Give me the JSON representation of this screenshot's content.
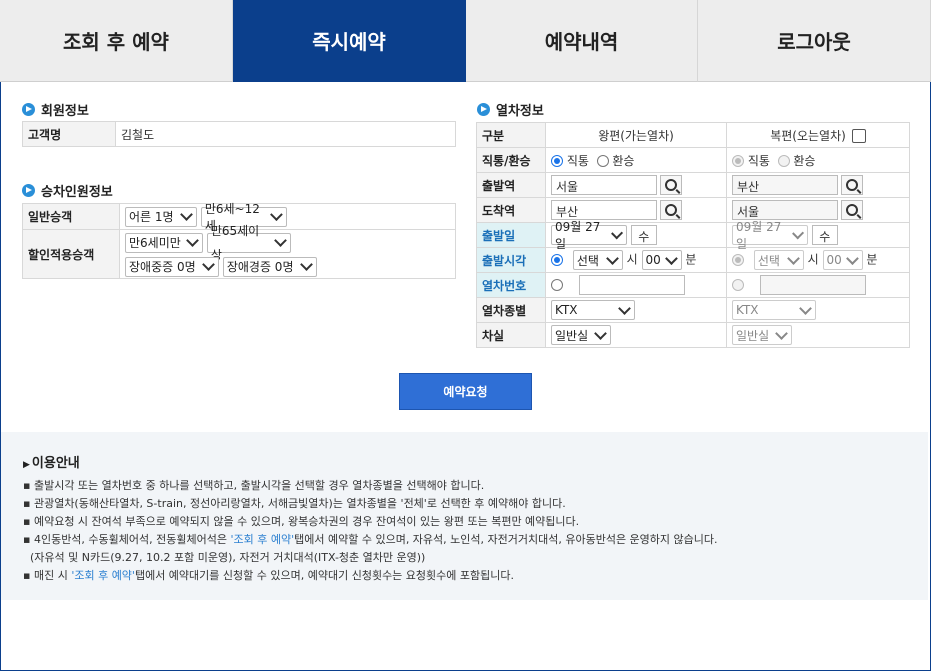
{
  "tabs": [
    {
      "label": "조회 후 예약",
      "active": false
    },
    {
      "label": "즉시예약",
      "active": true
    },
    {
      "label": "예약내역",
      "active": false
    },
    {
      "label": "로그아웃",
      "active": false
    }
  ],
  "member": {
    "title": "회원정보",
    "name_label": "고객명",
    "name_value": "김철도"
  },
  "passenger": {
    "title": "승차인원정보",
    "general_label": "일반승객",
    "adult": "어른 1명",
    "child": "만6세~12세",
    "discount_label": "할인적용승객",
    "under6": "만6세미만",
    "senior": "만65세이상",
    "disabled_severe": "장애중증 0명",
    "disabled_mild": "장애경증 0명"
  },
  "train": {
    "title": "열차정보",
    "col_label": "구분",
    "col_outbound": "왕편(가는열차)",
    "col_return": "복편(오는열차)",
    "row_direct": "직통/환승",
    "direct": "직통",
    "transfer": "환승",
    "row_dep": "출발역",
    "row_arr": "도착역",
    "row_date": "출발일",
    "row_time": "출발시각",
    "row_trainno": "열차번호",
    "row_type": "열차종별",
    "row_seat": "차실",
    "out": {
      "dep": "서울",
      "arr": "부산",
      "date": "09월 27일",
      "day": "수",
      "hour_sel": "선택",
      "hour_unit": "시",
      "min": "00",
      "min_unit": "분",
      "type": "KTX",
      "seat": "일반실"
    },
    "ret": {
      "dep": "부산",
      "arr": "서울",
      "date": "09월 27일",
      "day": "수",
      "hour_sel": "선택",
      "hour_unit": "시",
      "min": "00",
      "min_unit": "분",
      "type": "KTX",
      "seat": "일반실"
    }
  },
  "request_button": "예약요청",
  "info": {
    "title": "이용안내",
    "items": [
      "출발시각 또는 열차번호 중 하나를 선택하고, 출발시각을 선택할 경우 열차종별을 선택해야 합니다.",
      "관광열차(동해산타열차, S-train, 정선아리랑열차, 서해금빛열차)는 열차종별을 '전체'로 선택한 후 예약해야 합니다.",
      "예약요청 시 잔여석 부족으로 예약되지 않을 수 있으며, 왕복승차권의 경우 잔여석이 있는 왕편 또는 복편만 예약됩니다."
    ],
    "item4_a": "4인동반석, 수동휠체어석, 전동휠체어석은 ",
    "item4_link": "'조회 후 예약'",
    "item4_b": "탭에서 예약할 수 있으며, 자유석, 노인석, 자전거거치대석, 유아동반석은 운영하지 않습니다.",
    "item4_c": "(자유석 및 N카드(9.27, 10.2 포함 미운영), 자전거 거치대석(ITX-청춘 열차만 운영))",
    "item5_a": "매진 시 ",
    "item5_link": "'조회 후 예약'",
    "item5_b": "탭에서 예약대기를 신청할 수 있으며, 예약대기 신청횟수는 요청횟수에 포함됩니다."
  }
}
